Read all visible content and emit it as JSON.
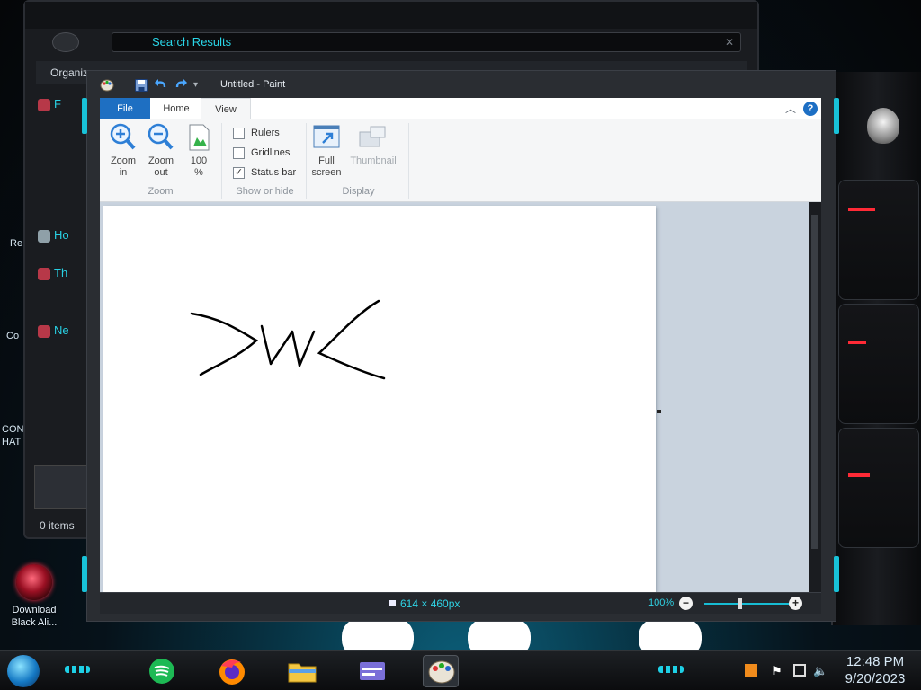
{
  "desktop": {
    "icons": [
      {
        "label_line1": "Download",
        "label_line2": "Black Ali..."
      }
    ],
    "edge_labels": [
      "Re",
      "Co",
      "CON",
      "HAT"
    ]
  },
  "explorer": {
    "address_text": "Search Results",
    "toolbar_label": "Organiz",
    "nav_items": [
      "F",
      "Ho",
      "Th",
      "Ne"
    ],
    "status_text": "0 items"
  },
  "paint": {
    "title": "Untitled - Paint",
    "tabs": {
      "file": "File",
      "home": "Home",
      "view": "View"
    },
    "ribbon": {
      "zoom_group": {
        "label": "Zoom",
        "zoom_in": {
          "line1": "Zoom",
          "line2": "in"
        },
        "zoom_out": {
          "line1": "Zoom",
          "line2": "out"
        },
        "hundred": {
          "line1": "100",
          "line2": "%"
        }
      },
      "show_hide_group": {
        "label": "Show or hide",
        "rulers": {
          "label": "Rulers",
          "checked": false
        },
        "gridlines": {
          "label": "Gridlines",
          "checked": false
        },
        "status_bar": {
          "label": "Status bar",
          "checked": true
        }
      },
      "display_group": {
        "label": "Display",
        "full_screen": {
          "line1": "Full",
          "line2": "screen"
        },
        "thumbnail": {
          "label": "Thumbnail"
        }
      }
    },
    "status": {
      "canvas_size": "614 × 460px",
      "zoom_level": "100%"
    }
  },
  "taskbar": {
    "clock_time": "12:48 PM",
    "clock_date": "9/20/2023"
  },
  "colors": {
    "accent_cyan": "#2ad6e8",
    "file_tab_blue": "#1e6fc2",
    "gadget_red": "#ff2a36"
  },
  "icons": {
    "paint_app": "paint-palette-icon",
    "save": "floppy-disk-icon",
    "undo": "undo-arrow-icon",
    "redo": "redo-arrow-icon",
    "help": "help-icon",
    "zoom_in": "magnifier-plus-icon",
    "zoom_out": "magnifier-minus-icon",
    "full_screen": "full-screen-icon",
    "thumbnail": "thumbnail-icon"
  }
}
